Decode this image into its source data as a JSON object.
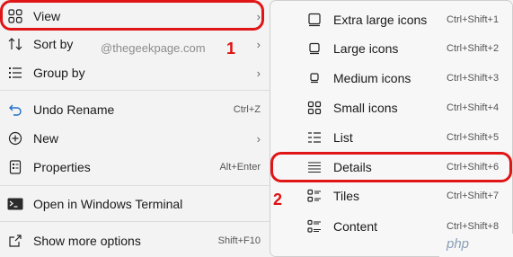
{
  "context_menu": {
    "items": [
      {
        "label": "View",
        "icon": "grid-icon",
        "has_submenu": true
      },
      {
        "label": "Sort by",
        "icon": "sort-arrows-icon",
        "has_submenu": true
      },
      {
        "label": "Group by",
        "icon": "list-icon",
        "has_submenu": true
      },
      {
        "label": "Undo Rename",
        "icon": "undo-icon",
        "shortcut": "Ctrl+Z"
      },
      {
        "label": "New",
        "icon": "plus-circle-icon",
        "has_submenu": true
      },
      {
        "label": "Properties",
        "icon": "properties-icon",
        "shortcut": "Alt+Enter"
      },
      {
        "label": "Open in Windows Terminal",
        "icon": "terminal-icon"
      },
      {
        "label": "Show more options",
        "icon": "share-icon",
        "shortcut": "Shift+F10"
      }
    ],
    "watermark": "@thegeekpage.com"
  },
  "view_submenu": {
    "items": [
      {
        "label": "Extra large icons",
        "icon": "extra-large-icons-icon",
        "shortcut": "Ctrl+Shift+1"
      },
      {
        "label": "Large icons",
        "icon": "large-icons-icon",
        "shortcut": "Ctrl+Shift+2"
      },
      {
        "label": "Medium icons",
        "icon": "medium-icons-icon",
        "shortcut": "Ctrl+Shift+3"
      },
      {
        "label": "Small icons",
        "icon": "small-icons-icon",
        "shortcut": "Ctrl+Shift+4"
      },
      {
        "label": "List",
        "icon": "list-view-icon",
        "shortcut": "Ctrl+Shift+5"
      },
      {
        "label": "Details",
        "icon": "details-view-icon",
        "shortcut": "Ctrl+Shift+6"
      },
      {
        "label": "Tiles",
        "icon": "tiles-view-icon",
        "shortcut": "Ctrl+Shift+7"
      },
      {
        "label": "Content",
        "icon": "content-view-icon",
        "shortcut": "Ctrl+Shift+8"
      }
    ]
  },
  "annotations": {
    "step1": "1",
    "step2": "2",
    "highlight_color": "#e01515"
  },
  "site_brand": "php"
}
